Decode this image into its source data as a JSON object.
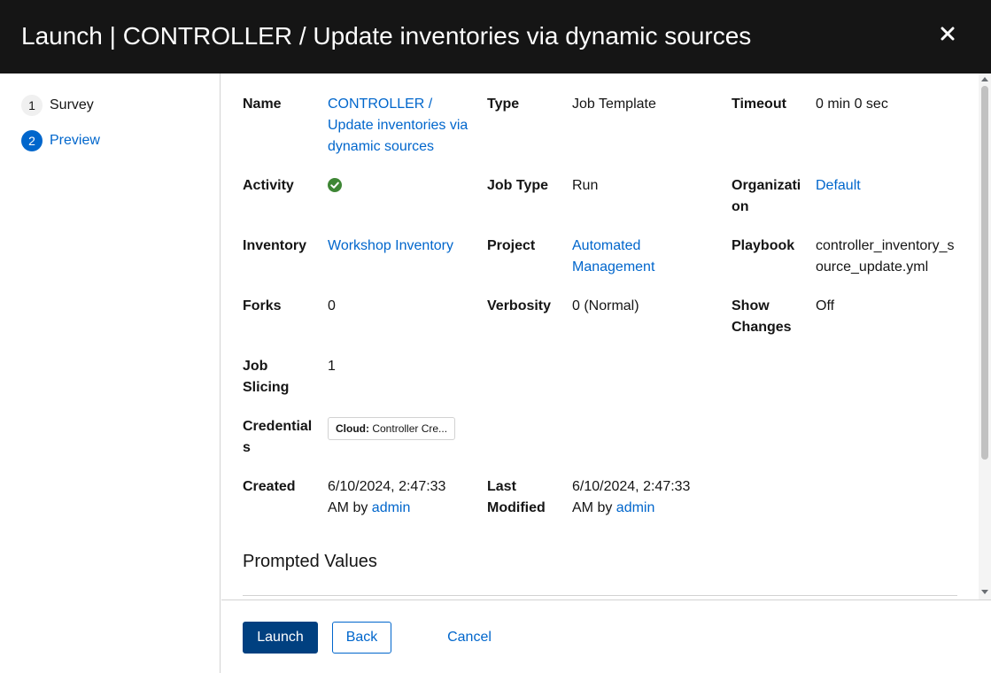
{
  "modal": {
    "title": "Launch | CONTROLLER / Update inventories via dynamic sources",
    "close_icon": "close-icon"
  },
  "wizard": {
    "steps": [
      {
        "number": "1",
        "label": "Survey",
        "active": false
      },
      {
        "number": "2",
        "label": "Preview",
        "active": true
      }
    ]
  },
  "details": {
    "name_label": "Name",
    "name_value": "CONTROLLER / Update inventories via dynamic sources",
    "type_label": "Type",
    "type_value": "Job Template",
    "timeout_label": "Timeout",
    "timeout_value": "0 min 0 sec",
    "activity_label": "Activity",
    "activity_icon": "success-check-icon",
    "job_type_label": "Job Type",
    "job_type_value": "Run",
    "organization_label": "Organization",
    "organization_value": "Default",
    "inventory_label": "Inventory",
    "inventory_value": "Workshop Inventory",
    "project_label": "Project",
    "project_value": "Automated Management",
    "playbook_label": "Playbook",
    "playbook_value": "controller_inventory_source_update.yml",
    "forks_label": "Forks",
    "forks_value": "0",
    "verbosity_label": "Verbosity",
    "verbosity_value": "0 (Normal)",
    "show_changes_label": "Show Changes",
    "show_changes_value": "Off",
    "job_slicing_label": "Job Slicing",
    "job_slicing_value": "1",
    "credentials_label": "Credentials",
    "credential_type": "Cloud:",
    "credential_name": "Controller Cre...",
    "created_label": "Created",
    "created_value": "6/10/2024, 2:47:33 AM by",
    "created_by": "admin",
    "last_modified_label": "Last Modified",
    "last_modified_value": "6/10/2024, 2:47:33 AM by",
    "last_modified_by": "admin"
  },
  "prompted_values": {
    "title": "Prompted Values"
  },
  "footer": {
    "launch_label": "Launch",
    "back_label": "Back",
    "cancel_label": "Cancel"
  },
  "colors": {
    "header_bg": "#151515",
    "link": "#0066cc",
    "primary_button": "#004080",
    "success": "#3e8635"
  }
}
